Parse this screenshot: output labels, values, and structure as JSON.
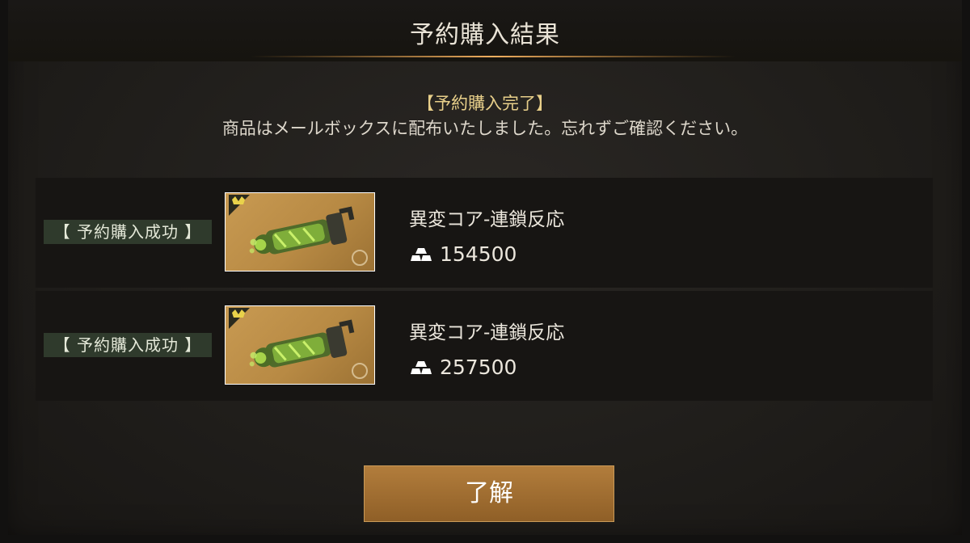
{
  "dialog": {
    "title": "予約購入結果"
  },
  "notice": {
    "heading": "【予約購入完了】",
    "message": "商品はメールボックスに配布いたしました。忘れずご確認ください。"
  },
  "items": [
    {
      "status": "【 予約購入成功 】",
      "name": "異変コア-連鎖反応",
      "price": "154500",
      "icon": "green-core-cannon-icon"
    },
    {
      "status": "【 予約購入成功 】",
      "name": "異変コア-連鎖反応",
      "price": "257500",
      "icon": "green-core-cannon-icon"
    }
  ],
  "currency_icon": "silver-ingot-icon",
  "ok_button": {
    "label": "了解"
  },
  "colors": {
    "accent_gold": "#e8cf8a",
    "button": "#a06e32",
    "status_bg": "#2f3a2c"
  }
}
